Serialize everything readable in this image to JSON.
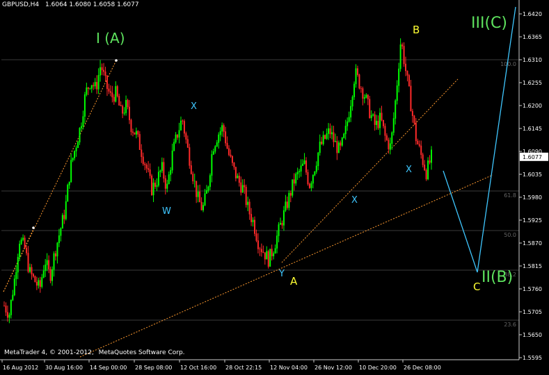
{
  "header": {
    "symbol": "GBPUSD,H4",
    "ohlc": "1.6064 1.6080 1.6058 1.6077"
  },
  "footer": {
    "copyright": "MetaQuotes Software Corp.",
    "copyright_prefix": "MetaTrader 4, © 2001-2012,"
  },
  "colors": {
    "background": "#000000",
    "grid": "#3a3a3a",
    "bull_candle": "#00ff00",
    "bear_candle": "#ff2a2a",
    "fib_trend": "#ff9a2f",
    "wave_cyan": "#3fc7ff",
    "wave_green": "#5ee35e",
    "wave_yellow": "#ffff33",
    "axis_text": "#ffffff",
    "price_box": "#ffffff"
  },
  "chart_data": {
    "type": "candlestick",
    "price_axis": {
      "ticks": [
        "1.6420",
        "1.6365",
        "1.6310",
        "1.6255",
        "1.6200",
        "1.6145",
        "1.6090",
        "1.6035",
        "1.5980",
        "1.5925",
        "1.5870",
        "1.5815",
        "1.5760",
        "1.5705",
        "1.5650",
        "1.5595"
      ],
      "min": 1.5595,
      "max": 1.642,
      "current_price": "1.6077"
    },
    "time_axis": {
      "ticks": [
        "16 Aug 2012",
        "30 Aug 16:00",
        "14 Sep 00:00",
        "28 Sep 08:00",
        "12 Oct 16:00",
        "28 Oct 22:15",
        "12 Nov 04:00",
        "26 Nov 12:00",
        "10 Dec 20:00",
        "26 Dec 08:00"
      ]
    },
    "fib_levels": [
      {
        "label": "100.0",
        "price": 1.631
      },
      {
        "label": "61.8",
        "price": 1.5995
      },
      {
        "label": "50.0",
        "price": 1.59
      },
      {
        "label": "38.2",
        "price": 1.5805
      },
      {
        "label": "23.6",
        "price": 1.5685
      }
    ],
    "wave_labels": [
      {
        "text": "I (A)",
        "color": "green"
      },
      {
        "text": "W",
        "color": "cyan"
      },
      {
        "text": "X",
        "color": "cyan"
      },
      {
        "text": "Y",
        "color": "cyan"
      },
      {
        "text": "X",
        "color": "cyan"
      },
      {
        "text": "X",
        "color": "cyan"
      },
      {
        "text": "A",
        "color": "yellow"
      },
      {
        "text": "B",
        "color": "yellow"
      },
      {
        "text": "C",
        "color": "yellow"
      },
      {
        "text": "II(B)",
        "color": "green"
      },
      {
        "text": "III(C)",
        "color": "green"
      }
    ],
    "price_path": [
      1.572,
      1.57,
      1.578,
      1.588,
      1.586,
      1.58,
      1.578,
      1.576,
      1.583,
      1.579,
      1.585,
      1.59,
      1.595,
      1.605,
      1.61,
      1.615,
      1.623,
      1.626,
      1.624,
      1.63,
      1.625,
      1.622,
      1.623,
      1.618,
      1.62,
      1.615,
      1.613,
      1.609,
      1.605,
      1.6,
      1.602,
      1.605,
      1.6,
      1.608,
      1.613,
      1.617,
      1.61,
      1.604,
      1.598,
      1.595,
      1.6,
      1.61,
      1.613,
      1.615,
      1.609,
      1.605,
      1.602,
      1.6,
      1.595,
      1.592,
      1.587,
      1.585,
      1.583,
      1.586,
      1.59,
      1.594,
      1.598,
      1.602,
      1.604,
      1.606,
      1.601,
      1.605,
      1.61,
      1.612,
      1.614,
      1.611,
      1.609,
      1.613,
      1.62,
      1.628,
      1.625,
      1.622,
      1.618,
      1.615,
      1.617,
      1.612,
      1.61,
      1.622,
      1.636,
      1.628,
      1.62,
      1.612,
      1.608,
      1.604,
      1.6077
    ]
  }
}
